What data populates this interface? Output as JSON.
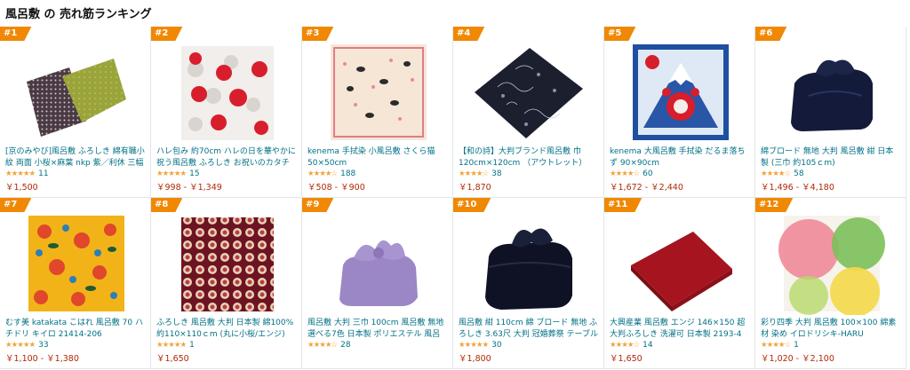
{
  "page": {
    "title": "風呂敷 の 売れ筋ランキング"
  },
  "colors": {
    "rank_badge": "#f08804",
    "link": "#007185",
    "price": "#b12704",
    "star": "#f0a33a"
  },
  "items": [
    {
      "rank": "#1",
      "name": "[京のみやび]風呂敷 ふろしき 綿有職小紋 両面 小桜×麻葉 nkp 紫／利休 三幅",
      "stars": "★★★★★",
      "rating": 4.7,
      "reviews": "11",
      "price": "￥1,500"
    },
    {
      "rank": "#2",
      "name": "ハレ包み 約70cm ハレの日を華やかに祝う風呂敷 ふろしき お祝いのカタチ お祝",
      "stars": "★★★★★",
      "rating": 4.6,
      "reviews": "15",
      "price": "￥998 - ￥1,349"
    },
    {
      "rank": "#3",
      "name": "kenema 手拭染 小風呂敷 さくら猫 50×50cm",
      "stars": "★★★★☆",
      "rating": 4.4,
      "reviews": "188",
      "price": "￥508 - ￥900"
    },
    {
      "rank": "#4",
      "name": "【和の詩】大判ブランド風呂敷 巾 120cm×120cm （アウトレット）",
      "stars": "★★★★☆",
      "rating": 4.3,
      "reviews": "38",
      "price": "￥1,870"
    },
    {
      "rank": "#5",
      "name": "kenema 大風呂敷 手拭染 だるま落ちず 90×90cm",
      "stars": "★★★★☆",
      "rating": 4.4,
      "reviews": "60",
      "price": "￥1,672 - ￥2,440"
    },
    {
      "rank": "#6",
      "name": "綿ブロード 無地 大判 風呂敷 紺 日本製 (三巾 約105ｃm)",
      "stars": "★★★★☆",
      "rating": 4.2,
      "reviews": "58",
      "price": "￥1,496 - ￥4,180"
    },
    {
      "rank": "#7",
      "name": "むす美 katakata こはれ 風呂敷 70 ハチドリ キイロ 21414-206",
      "stars": "★★★★★",
      "rating": 4.7,
      "reviews": "33",
      "price": "￥1,100 - ￥1,380"
    },
    {
      "rank": "#8",
      "name": "ふろしき 風呂敷 大判 日本製 綿100% 約110×110ｃm (丸に小桜/エンジ)",
      "stars": "★★★★★",
      "rating": 5.0,
      "reviews": "1",
      "price": "￥1,650"
    },
    {
      "rank": "#9",
      "name": "風呂敷 大判 三巾 100cm 風呂敷 無地 選べる7色 日本製 ポリエステル 風呂敷 着付け小物 専用 下駄 等 日本伝統 持ち運び",
      "stars": "★★★★☆",
      "rating": 4.1,
      "reviews": "28",
      "price": ""
    },
    {
      "rank": "#10",
      "name": "風呂敷 紺 110cm 綿 ブロード 無地 ふろしき 3.63尺 大判 冠婚葬祭 テーブルクロ",
      "stars": "★★★★★",
      "rating": 4.6,
      "reviews": "30",
      "price": "￥1,800"
    },
    {
      "rank": "#11",
      "name": "大興産業 風呂敷 エンジ 146×150 超大判ふろしき 洗濯可 日本製 2193-4",
      "stars": "★★★★☆",
      "rating": 4.1,
      "reviews": "14",
      "price": "￥1,650"
    },
    {
      "rank": "#12",
      "name": "彩り四季 大判 風呂敷 100×100 綿素材 染め イロドリシキ-HARU",
      "stars": "★★★★☆",
      "rating": 4.0,
      "reviews": "1",
      "price": "￥1,020 - ￥2,100"
    }
  ]
}
